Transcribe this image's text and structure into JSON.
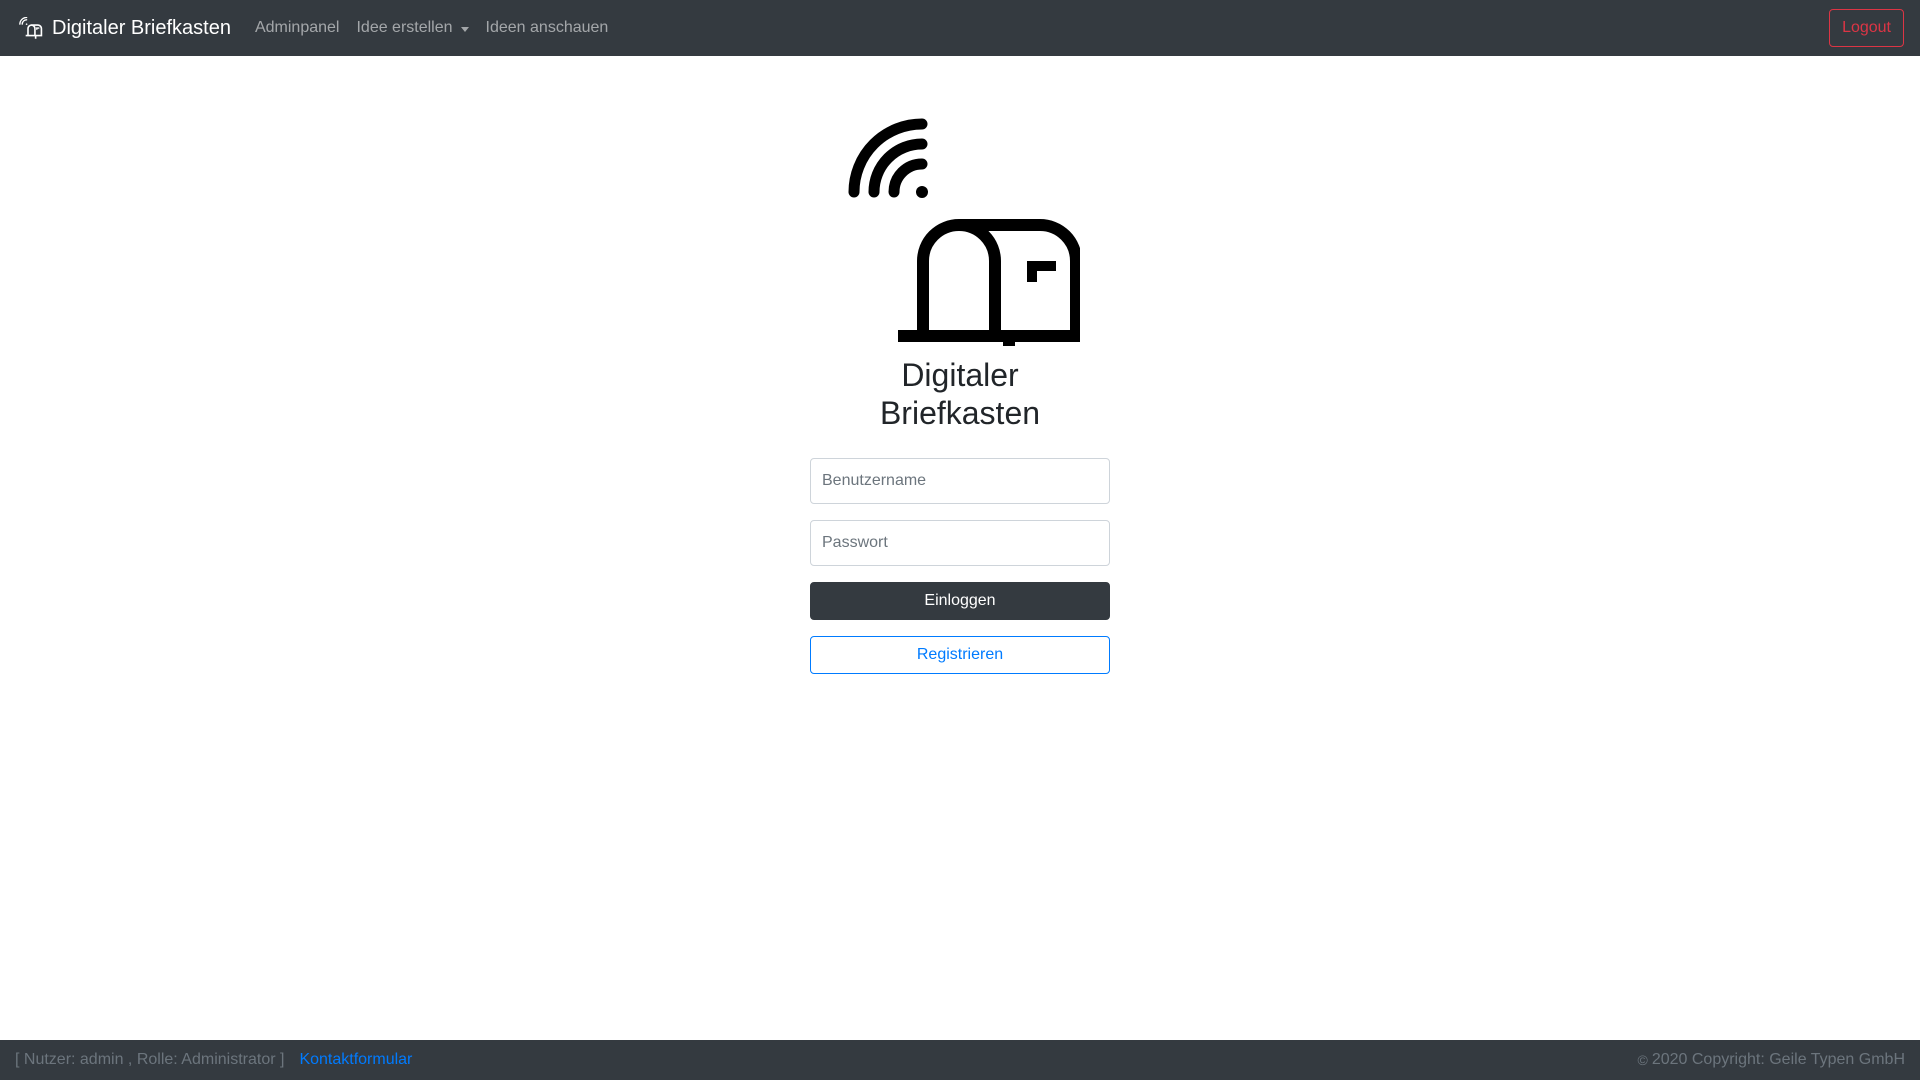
{
  "navbar": {
    "brand_label": "Digitaler Briefkasten",
    "brand_icon": "mailbox-wifi-icon",
    "items": [
      {
        "label": "Adminpanel"
      },
      {
        "label": "Idee erstellen",
        "dropdown": true
      },
      {
        "label": "Ideen anschauen"
      }
    ],
    "logout_label": "Logout",
    "background": "#343a40",
    "logout_color": "#dc3545"
  },
  "main": {
    "logo_icon": "mailbox-wifi-icon",
    "title_line1": "Digitaler",
    "title_line2": "Briefkasten",
    "username_placeholder": "Benutzername",
    "password_placeholder": "Passwort",
    "login_label": "Einloggen",
    "register_label": "Registrieren",
    "accent_color": "#007bff"
  },
  "footer": {
    "user_info": "[ Nutzer: admin , Rolle: Administrator ]",
    "contact_label": "Kontaktformular",
    "copyright_symbol": "©",
    "copyright": "2020 Copyright: Geile Typen GmbH"
  }
}
